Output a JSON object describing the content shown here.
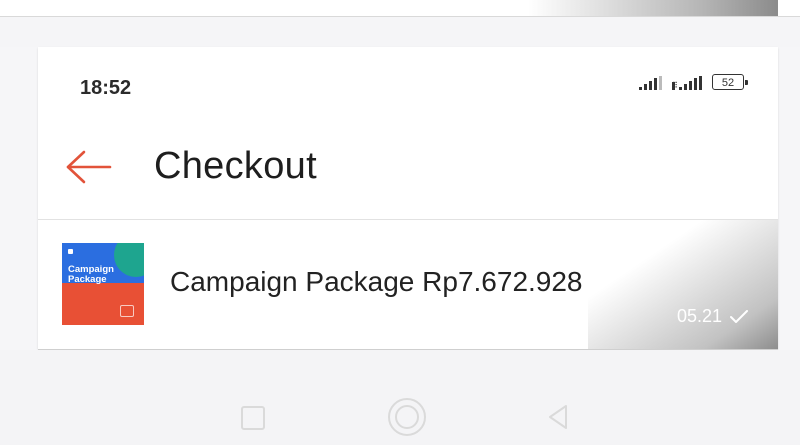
{
  "status_bar": {
    "time": "18:52",
    "battery": "52"
  },
  "header": {
    "back_icon": "arrow-left-icon",
    "title": "Checkout"
  },
  "chat": {
    "thumbnail_text": "Campaign Package",
    "message": "Campaign Package Rp7.672.928",
    "timestamp": "05.21",
    "status_icon": "check-icon"
  },
  "colors": {
    "accent": "#e2533a",
    "thumb_blue": "#2b6ee0",
    "thumb_teal": "#1ea58f",
    "thumb_orange": "#e85035"
  },
  "navbar": {
    "icons": [
      "recent-apps-icon",
      "home-icon",
      "back-icon"
    ]
  }
}
